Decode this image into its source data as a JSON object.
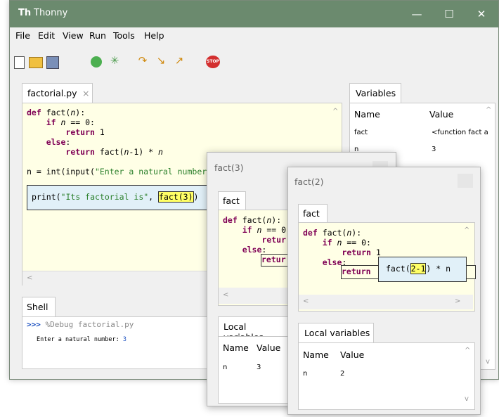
{
  "window": {
    "title": "Thonny",
    "minimize": "—",
    "maximize": "☐",
    "close": "✕"
  },
  "menu": [
    "File",
    "Edit",
    "View",
    "Run",
    "Tools",
    "Help"
  ],
  "toolbar": {
    "new": "new-file-icon",
    "open": "open-folder-icon",
    "save": "save-icon",
    "run": "run-icon",
    "debug": "debug-icon",
    "step_over": "step-over-icon",
    "step_into": "step-into-icon",
    "step_out": "step-out-icon",
    "stop": "stop-icon",
    "stop_label": "STOP"
  },
  "editor": {
    "tab_label": "factorial.py",
    "tab_close": "×",
    "code": [
      "def fact(n):",
      "    if n == 0:",
      "        return 1",
      "    else:",
      "        return fact(n-1) * n",
      "",
      "n = int(input(\"Enter a natural number"
    ],
    "eval_box": "print(\"Its factorial is\", fact(3))"
  },
  "variables": {
    "tab_label": "Variables",
    "col_name": "Name",
    "col_value": "Value",
    "rows": [
      {
        "name": "fact",
        "value": "<function fact a"
      },
      {
        "name": "n",
        "value": "3"
      }
    ]
  },
  "shell": {
    "tab_label": "Shell",
    "prompt": ">>>",
    "command": "%Debug factorial.py",
    "output": "Enter a natural number: ",
    "input": "3"
  },
  "frame3": {
    "title": "fact(3)",
    "tab_label": "fact",
    "code": [
      "def fact(n):",
      "    if n == 0",
      "        retur",
      "    else:",
      "        retur"
    ],
    "locals_tab": "Local variables",
    "col_name": "Name",
    "col_value": "Value",
    "rows": [
      {
        "name": "n",
        "value": "3"
      }
    ]
  },
  "frame2": {
    "title": "fact(2)",
    "tab_label": "fact",
    "code": [
      "def fact(n):",
      "    if n == 0:",
      "        return 1",
      "    else:",
      "        return"
    ],
    "eval_box": "fact(2-1) * n",
    "locals_tab": "Local variables",
    "col_name": "Name",
    "col_value": "Value",
    "rows": [
      {
        "name": "n",
        "value": "2"
      }
    ]
  },
  "colors": {
    "titlebar": "#6b8a6e",
    "editor_bg": "#ffffe6",
    "keyword": "#7f0055",
    "string": "#2a7f2a",
    "highlight": "#ffff66"
  }
}
